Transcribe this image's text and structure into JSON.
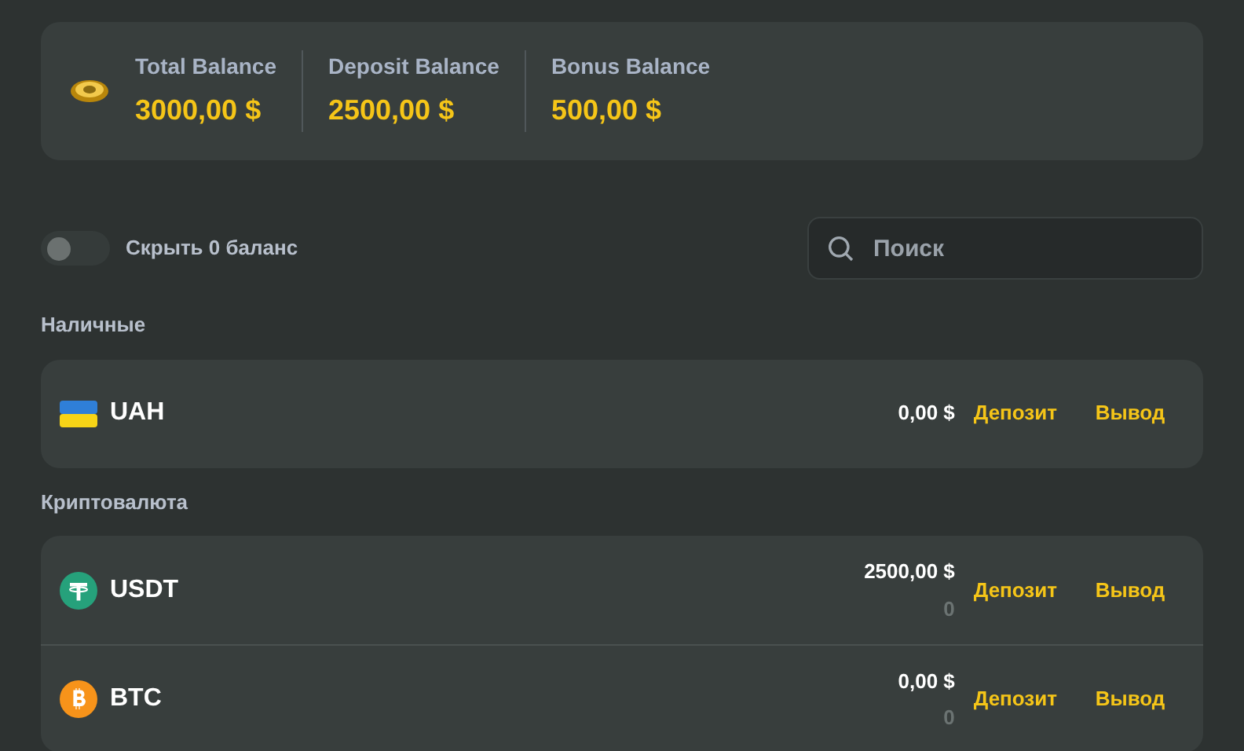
{
  "balances": [
    {
      "label": "Total Balance",
      "value": "3000,00 $"
    },
    {
      "label": "Deposit Balance",
      "value": "2500,00 $"
    },
    {
      "label": "Bonus Balance",
      "value": "500,00 $"
    }
  ],
  "hide_zero": {
    "label": "Скрыть 0 баланс",
    "on": false
  },
  "search": {
    "placeholder": "Поиск"
  },
  "sections": [
    {
      "title": "Наличные",
      "accounts": [
        {
          "kind": "flag",
          "code": "UAH",
          "amount": "0,00 $",
          "deposit": "Депозит",
          "withdraw": "Вывод"
        }
      ]
    },
    {
      "title": "Криптовалюта",
      "accounts": [
        {
          "kind": "tether",
          "code": "USDT",
          "amount": "2500,00 $",
          "secondary": "0",
          "deposit": "Депозит",
          "withdraw": "Вывод"
        },
        {
          "kind": "bitcoin",
          "code": "BTC",
          "amount": "0,00 $",
          "secondary": "0",
          "deposit": "Депозит",
          "withdraw": "Вывод"
        }
      ]
    }
  ]
}
